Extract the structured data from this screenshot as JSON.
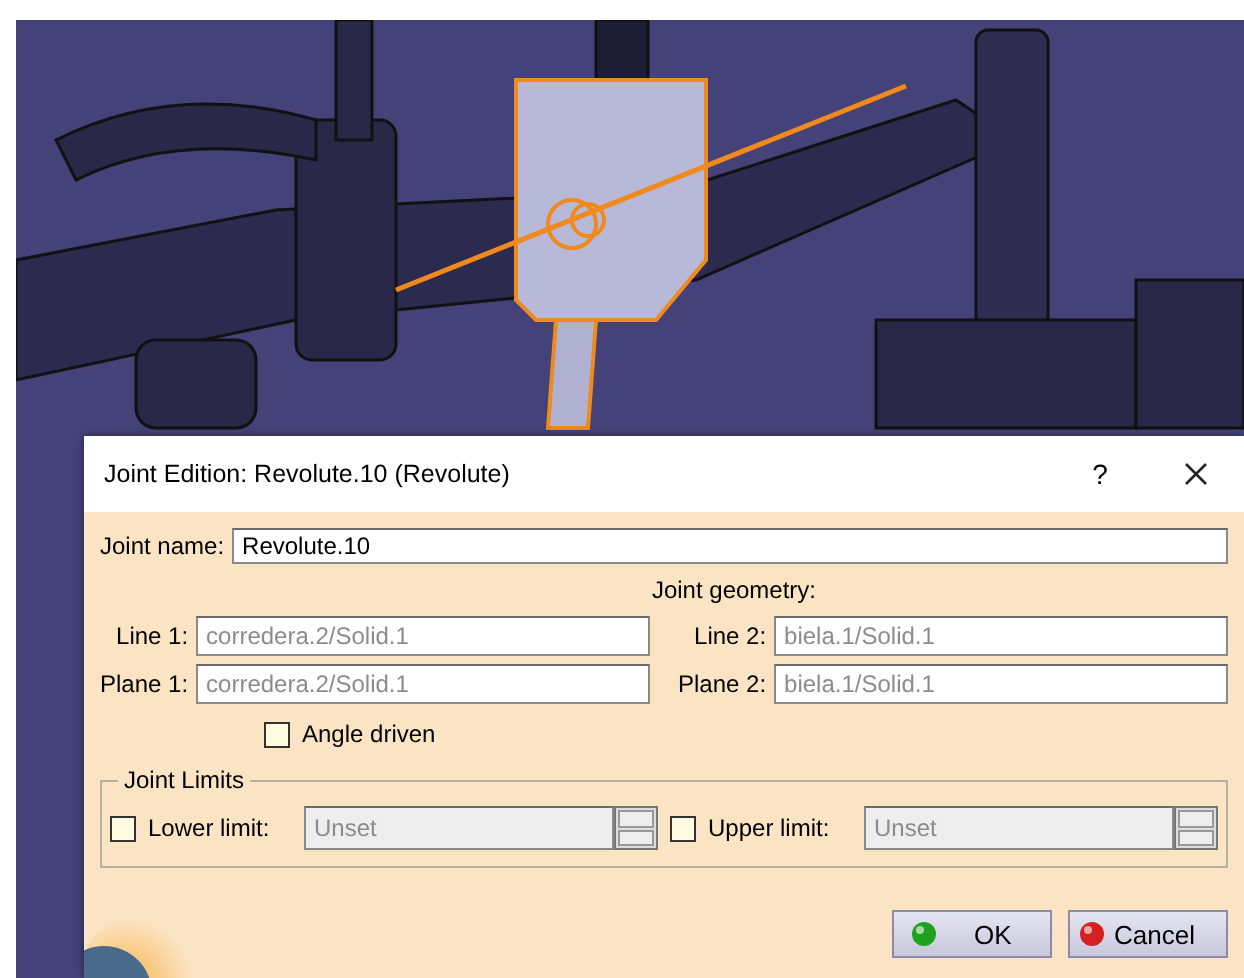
{
  "dialog": {
    "title": "Joint Edition: Revolute.10 (Revolute)",
    "help": "?",
    "joint_name": {
      "label": "Joint name:",
      "value": "Revolute.10"
    },
    "geometry": {
      "heading": "Joint geometry:",
      "fields": [
        {
          "label": "Line 1:",
          "value": "corredera.2/Solid.1",
          "disabled": true
        },
        {
          "label": "Line 2:",
          "value": "biela.1/Solid.1",
          "disabled": true
        },
        {
          "label": "Plane 1:",
          "value": "corredera.2/Solid.1",
          "disabled": true
        },
        {
          "label": "Plane 2:",
          "value": "biela.1/Solid.1",
          "disabled": true
        }
      ]
    },
    "angle_driven": {
      "label": "Angle driven",
      "checked": false
    },
    "limits": {
      "title": "Joint Limits",
      "items": [
        {
          "label": "Lower limit:",
          "checked": false,
          "value": "Unset",
          "disabled": true
        },
        {
          "label": "Upper limit:",
          "checked": false,
          "value": "Unset",
          "disabled": true
        }
      ]
    },
    "buttons": [
      {
        "label": "OK",
        "kind": "ok"
      },
      {
        "label": "Cancel",
        "kind": "cancel"
      }
    ]
  }
}
